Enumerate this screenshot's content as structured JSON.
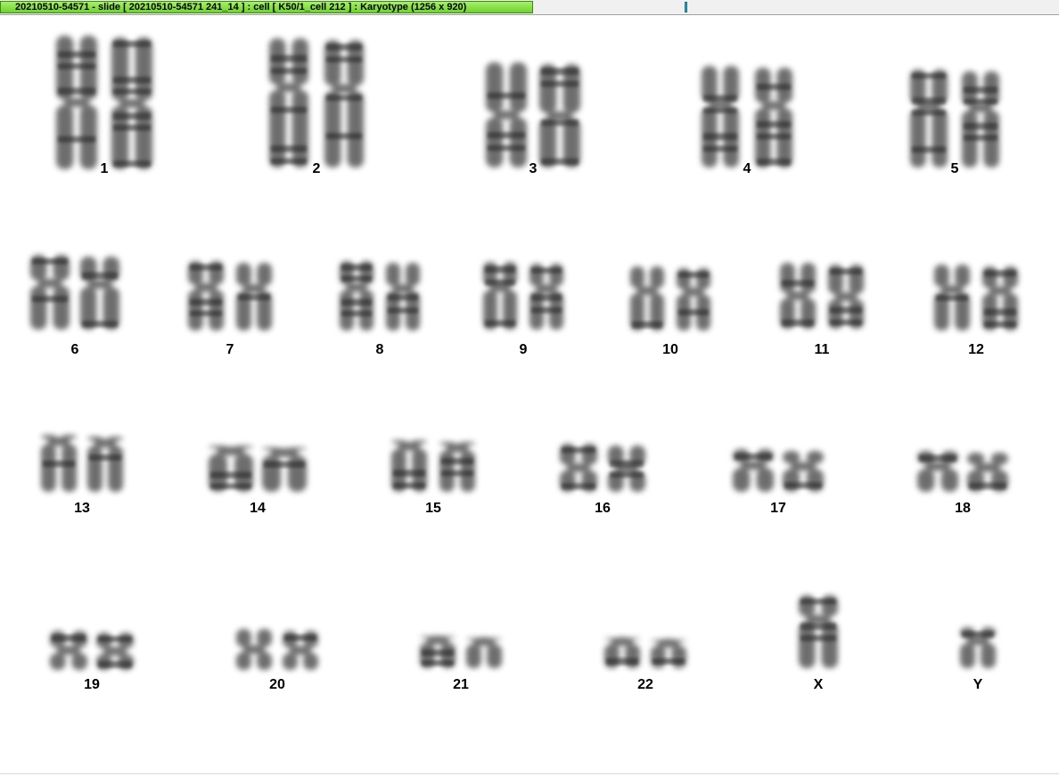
{
  "window": {
    "title": "20210510-54571 - slide [ 20210510-54571 241_14 ] : cell [ K50/1_cell 212 ] : Karyotype  (1256 x 920)"
  },
  "karyotype": [
    {
      "label": "1",
      "shape": "large-meta"
    },
    {
      "label": "2",
      "shape": "large-submeta"
    },
    {
      "label": "3",
      "shape": "large-meta"
    },
    {
      "label": "4",
      "shape": "large-submeta"
    },
    {
      "label": "5",
      "shape": "large-submeta"
    },
    {
      "label": "6",
      "shape": "medium-submeta"
    },
    {
      "label": "7",
      "shape": "medium-submeta"
    },
    {
      "label": "8",
      "shape": "medium-submeta"
    },
    {
      "label": "9",
      "shape": "medium-submeta"
    },
    {
      "label": "10",
      "shape": "medium-submeta"
    },
    {
      "label": "11",
      "shape": "medium-meta"
    },
    {
      "label": "12",
      "shape": "medium-submeta"
    },
    {
      "label": "13",
      "shape": "acro"
    },
    {
      "label": "14",
      "shape": "acro"
    },
    {
      "label": "15",
      "shape": "acro"
    },
    {
      "label": "16",
      "shape": "small-meta"
    },
    {
      "label": "17",
      "shape": "small-submeta"
    },
    {
      "label": "18",
      "shape": "small-submeta"
    },
    {
      "label": "19",
      "shape": "small-meta"
    },
    {
      "label": "20",
      "shape": "small-meta"
    },
    {
      "label": "21",
      "shape": "small-acro"
    },
    {
      "label": "22",
      "shape": "small-acro"
    },
    {
      "label": "X",
      "shape": "single"
    },
    {
      "label": "Y",
      "shape": "single"
    }
  ],
  "colors": {
    "title_tab": "#6fd22e",
    "chromosome": "#5a5a5a",
    "band": "#222222"
  }
}
